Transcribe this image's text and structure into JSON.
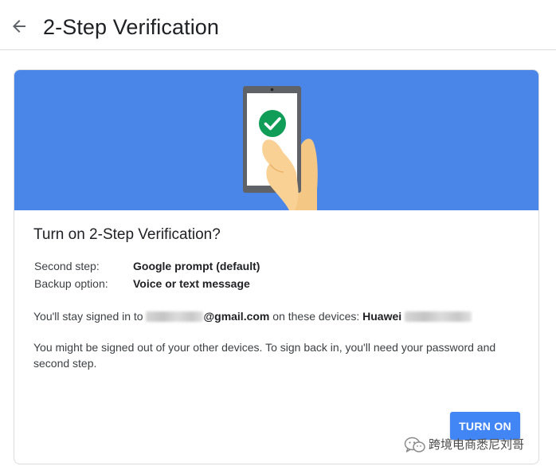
{
  "header": {
    "title": "2-Step Verification",
    "back_icon": "arrow-left-icon"
  },
  "banner": {
    "background_color": "#4a86e8",
    "illustration": "phone-checkmark-icon",
    "check_color": "#0f9d58"
  },
  "card": {
    "title": "Turn on 2-Step Verification?",
    "settings": [
      {
        "label": "Second step:",
        "value": "Google prompt (default)"
      },
      {
        "label": "Backup option:",
        "value": "Voice or text message"
      }
    ],
    "signed_in": {
      "prefix": "You'll stay signed in to",
      "email_suffix": "@gmail.com",
      "middle": "on these devices:",
      "device": "Huawei"
    },
    "warning": "You might be signed out of your other devices. To sign back in, you'll need your password and second step.",
    "turn_on_label": "TURN ON",
    "button_color": "#4285f4"
  },
  "watermark": {
    "text": "跨境电商悉尼刘哥",
    "icon": "wechat-icon"
  }
}
